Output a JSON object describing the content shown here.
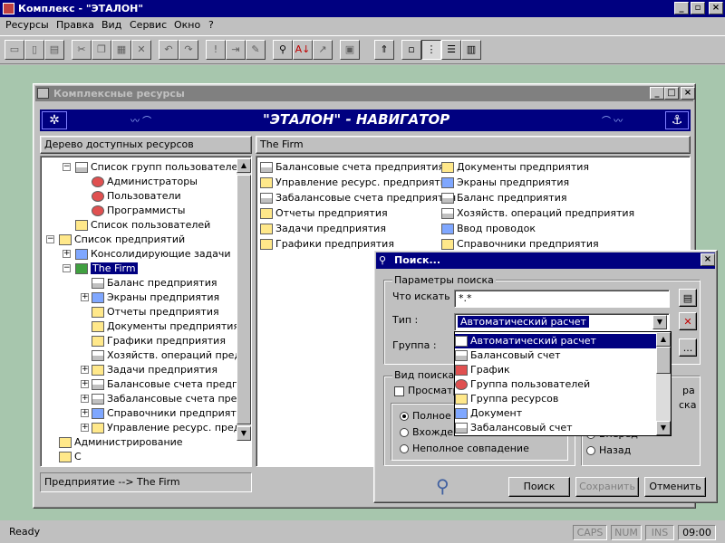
{
  "app": {
    "title": "Комплекс - \"ЭТАЛОН\""
  },
  "menu": [
    "Ресурсы",
    "Правка",
    "Вид",
    "Сервис",
    "Окно",
    "?"
  ],
  "toolbar_icons": [
    "save-icon",
    "print-preview-icon",
    "print-icon",
    "cut-icon",
    "copy-icon",
    "paste-icon",
    "delete-icon",
    "undo-icon",
    "redo-icon",
    "exclamation-icon",
    "export-icon",
    "edit-icon",
    "find-icon",
    "sort-az-icon",
    "sign-icon",
    "properties-icon",
    "folder-up-icon",
    "large-icons-icon",
    "small-icons-icon",
    "list-icon",
    "details-icon"
  ],
  "child": {
    "title": "Комплексные ресурсы",
    "banner": "\"ЭТАЛОН\" - НАВИГАТОР",
    "left_header": "Дерево доступных ресурсов",
    "right_header": "The Firm",
    "tree": [
      {
        "label": "Список групп пользователей",
        "level": 1
      },
      {
        "label": "Администраторы",
        "level": 2
      },
      {
        "label": "Пользователи",
        "level": 2
      },
      {
        "label": "Программисты",
        "level": 2
      },
      {
        "label": "Список пользователей",
        "level": 1
      },
      {
        "label": "Список предприятий",
        "level": 0
      },
      {
        "label": "Консолидирующие задачи",
        "level": 1
      },
      {
        "label": "The Firm",
        "level": 1
      },
      {
        "label": "Баланс предприятия",
        "level": 2
      },
      {
        "label": "Экраны предприятия",
        "level": 2
      },
      {
        "label": "Отчеты предприятия",
        "level": 2
      },
      {
        "label": "Документы предприятия",
        "level": 2
      },
      {
        "label": "Графики предприятия",
        "level": 2
      },
      {
        "label": "Хозяйств. операций предпр",
        "level": 2
      },
      {
        "label": "Задачи предприятия",
        "level": 2
      },
      {
        "label": "Балансовые счета предпри",
        "level": 2
      },
      {
        "label": "Забалансовые счета предп",
        "level": 2
      },
      {
        "label": "Справочники предприятия",
        "level": 2
      },
      {
        "label": "Управление ресурс. предп",
        "level": 2
      },
      {
        "label": "Администрирование",
        "level": 0
      },
      {
        "label": "С",
        "level": 0
      }
    ],
    "list_col1": [
      "Балансовые счета предприятия",
      "Управление ресурс. предприятия",
      "Забалансовые счета предприятия",
      "Отчеты предприятия",
      "Задачи предприятия",
      "Графики предприятия"
    ],
    "list_col2": [
      "Документы предприятия",
      "Экраны предприятия",
      "Баланс предприятия",
      "Хозяйств. операций предприятия",
      "Ввод проводок",
      "Справочники предприятия"
    ],
    "path": "Предприятие --> The Firm"
  },
  "dialog": {
    "title": "Поиск...",
    "params_group": "Параметры поиска",
    "what_label": "Что искать :",
    "what_value": "*.*",
    "type_label": "Тип :",
    "type_value": "Автоматический расчет",
    "group_label": "Группа :",
    "type_options": [
      "Автоматический расчет",
      "Балансовый счет",
      "График",
      "Группа пользователей",
      "Группа ресурсов",
      "Документ",
      "Забалансовый  счет"
    ],
    "view_group": "Вид поиска",
    "view_check": "Просматр",
    "match_options": [
      "Полное с",
      "Вхождение",
      "Неполное совпадение"
    ],
    "dir_partial_1": "ра",
    "dir_partial_2": "ска",
    "dir_options": [
      "Вперед",
      "Назад"
    ],
    "btn_search": "Поиск",
    "btn_save": "Сохранить",
    "btn_cancel": "Отменить",
    "browse": "..."
  },
  "status": {
    "text": "Ready",
    "caps": "CAPS",
    "num": "NUM",
    "ins": "INS",
    "time": "09:00"
  }
}
